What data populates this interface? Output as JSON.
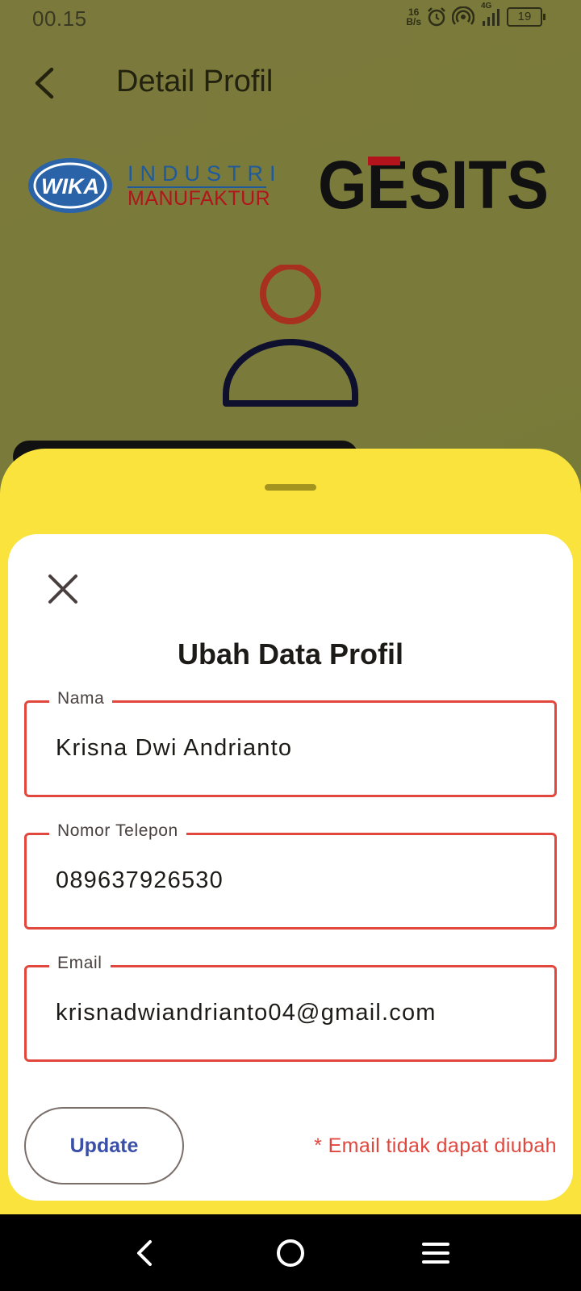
{
  "status_bar": {
    "time": "00.15",
    "speed_value": "16",
    "speed_unit": "B/s",
    "network": "4G",
    "battery": "19"
  },
  "header": {
    "title": "Detail Profil",
    "back_icon": "chevron-left-icon"
  },
  "logos": {
    "wika_mark": "WIKA",
    "wika_line1": "INDUSTRI",
    "wika_line2": "MANUFAKTUR",
    "gesits": "GESITS"
  },
  "dialog": {
    "title": "Ubah Data Profil",
    "close_icon": "close-icon",
    "fields": {
      "name": {
        "label": "Nama",
        "value": "Krisna Dwi Andrianto"
      },
      "phone": {
        "label": "Nomor Telepon",
        "value": "089637926530"
      },
      "email": {
        "label": "Email",
        "value": "krisnadwiandrianto04@gmail.com"
      }
    },
    "update_label": "Update",
    "email_note": "* Email tidak dapat diubah"
  },
  "colors": {
    "sheet": "#f9e33c",
    "error_border": "#e2473e",
    "button_text": "#3a4fa8",
    "wika_blue": "#1f5a9c",
    "wika_red": "#b3141c"
  }
}
